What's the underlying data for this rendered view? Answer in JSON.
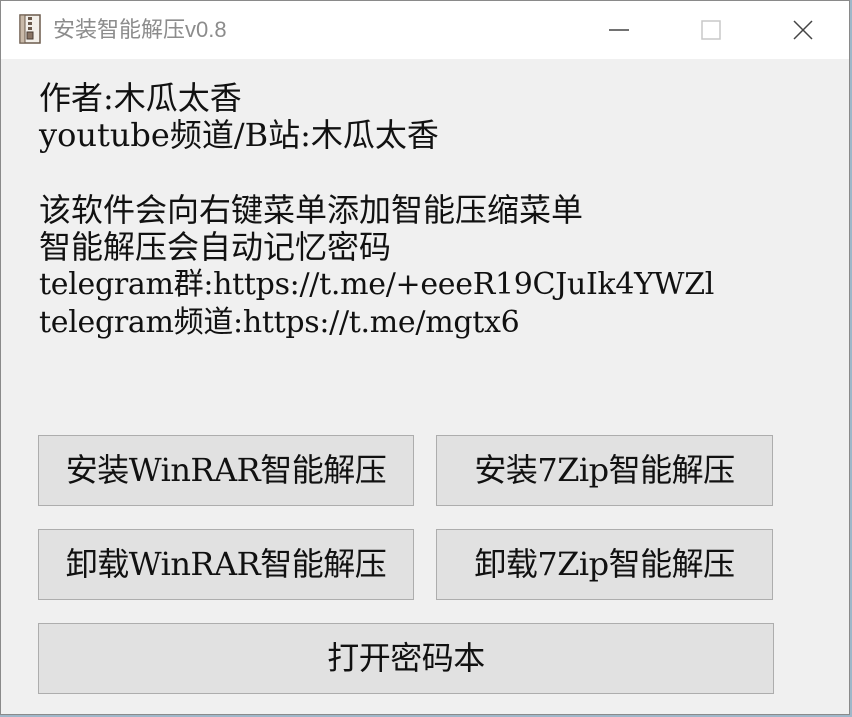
{
  "window": {
    "title": "安装智能解压v0.8",
    "icon": "archive-zipper-icon"
  },
  "info": {
    "author": "作者:木瓜太香",
    "channel": "youtube频道/B站:木瓜太香",
    "desc1": "该软件会向右键菜单添加智能压缩菜单",
    "desc2": "智能解压会自动记忆密码",
    "telegram_group": "telegram群:https://t.me/+eeeR19CJuIk4YWZl",
    "telegram_channel": "telegram频道:https://t.me/mgtx6"
  },
  "buttons": {
    "install_winrar": "安装WinRAR智能解压",
    "install_7zip": "安装7Zip智能解压",
    "uninstall_winrar": "卸载WinRAR智能解压",
    "uninstall_7zip": "卸载7Zip智能解压",
    "open_password_book": "打开密码本"
  }
}
